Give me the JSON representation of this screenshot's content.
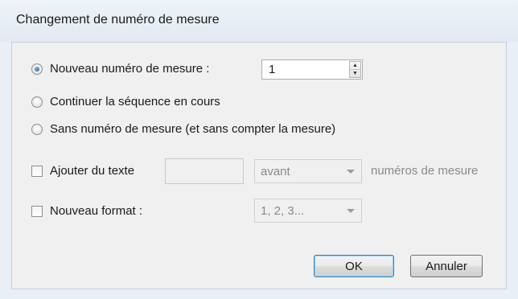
{
  "dialog": {
    "title": "Changement de numéro de mesure"
  },
  "options": {
    "new_number_label": "Nouveau numéro de mesure :",
    "new_number_value": "1",
    "continue_label": "Continuer la séquence en cours",
    "no_number_label": "Sans numéro de mesure (et sans compter la mesure)",
    "selected": "new_number"
  },
  "add_text": {
    "label": "Ajouter du texte",
    "text_value": "",
    "position_value": "avant",
    "suffix_label": "numéros de mesure",
    "checked": false
  },
  "new_format": {
    "label": "Nouveau format :",
    "value": "1, 2, 3...",
    "checked": false
  },
  "buttons": {
    "ok": "OK",
    "cancel": "Annuler"
  }
}
